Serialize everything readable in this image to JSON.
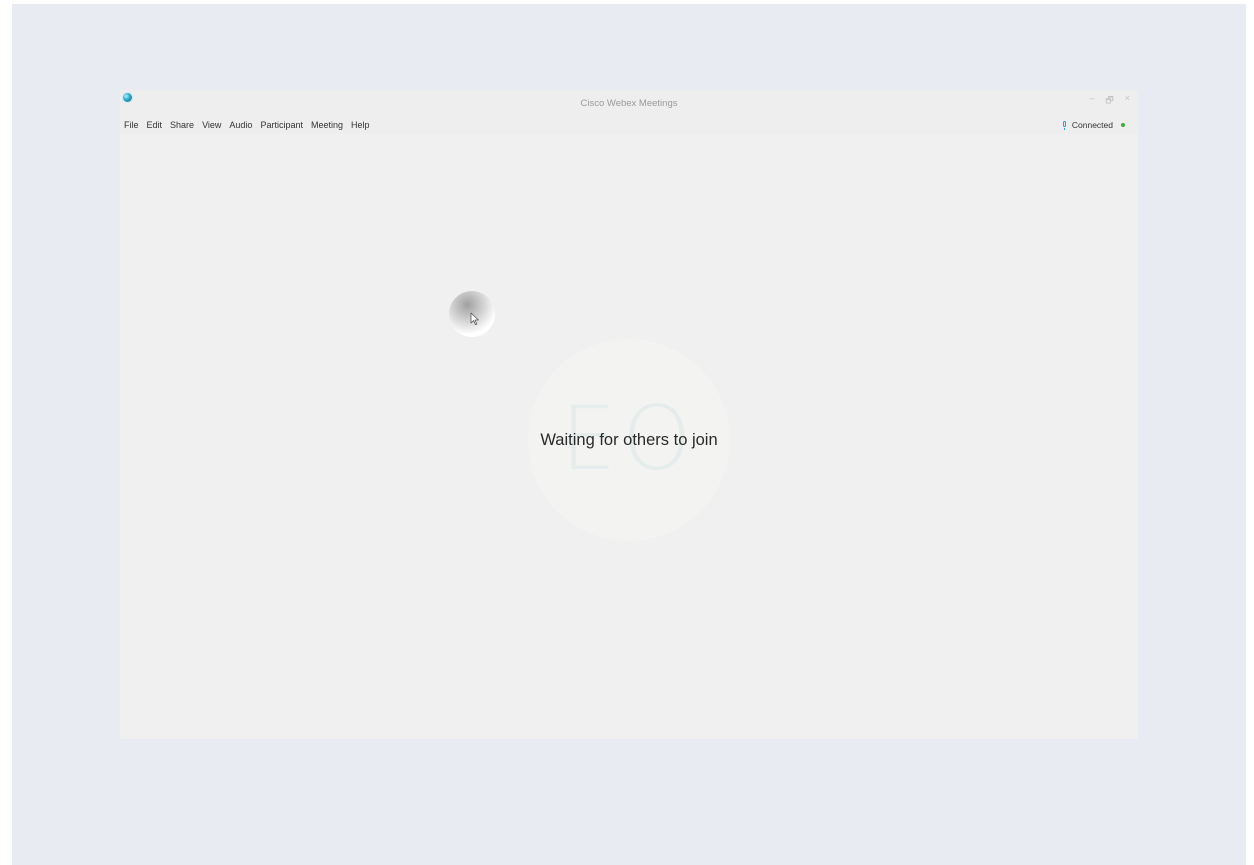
{
  "window": {
    "title": "Cisco Webex Meetings",
    "controls": {
      "minimize": "–",
      "restore": "🗗",
      "close": "×"
    }
  },
  "menu": {
    "items": [
      "File",
      "Edit",
      "Share",
      "View",
      "Audio",
      "Participant",
      "Meeting",
      "Help"
    ]
  },
  "status": {
    "label": "Connected",
    "dot_color": "#3aaf3a",
    "icon": "microphone-icon"
  },
  "stage": {
    "avatar_initials": "EO",
    "message": "Waiting for others to join"
  },
  "colors": {
    "desktop_bg": "#e8ebf2",
    "window_bg": "#f0f0f0",
    "accent": "#2b9fd0"
  }
}
